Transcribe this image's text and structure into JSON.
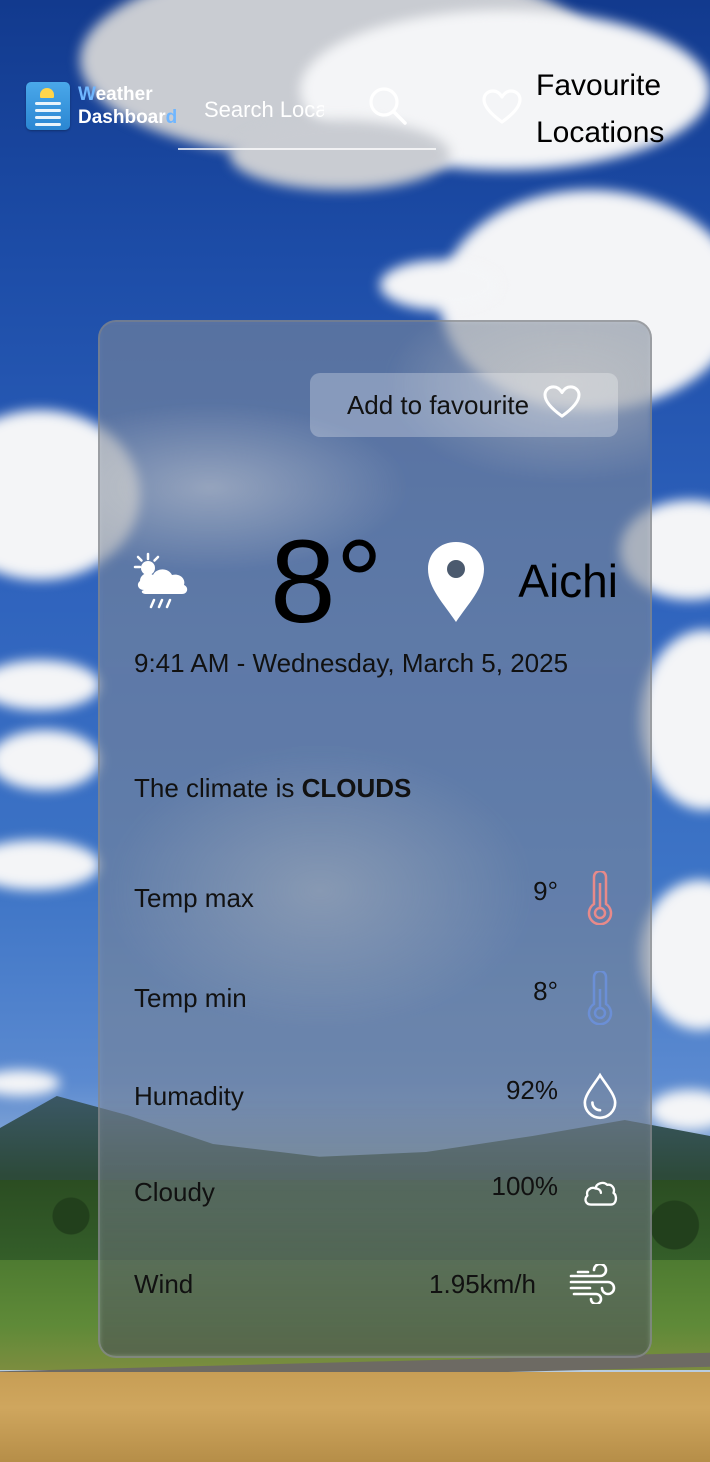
{
  "header": {
    "logo": {
      "line1": "Weather",
      "line2": "Dashboard"
    },
    "search": {
      "placeholder": "Search Location",
      "icon": "search-icon"
    },
    "favourites": {
      "label": "Favourite Locations",
      "icon": "heart-icon"
    }
  },
  "card": {
    "add_favourite_label": "Add to favourite",
    "weather_icon": "cloud-sun-rain-icon",
    "temperature": "8°",
    "city": "Aichi",
    "datetime": "9:41 AM - Wednesday, March 5, 2025",
    "climate_prefix": "The climate is",
    "climate": "CLOUDS",
    "stats": [
      {
        "label": "Temp max",
        "value": "9°",
        "icon": "thermometer-hot-icon",
        "color": "#e88a8a"
      },
      {
        "label": "Temp min",
        "value": "8°",
        "icon": "thermometer-cold-icon",
        "color": "#6b8fd6"
      },
      {
        "label": "Humadity",
        "value": "92%",
        "icon": "droplet-icon",
        "color": "#ffffff"
      },
      {
        "label": "Cloudy",
        "value": "100%",
        "icon": "cloud-icon",
        "color": "#ffffff"
      },
      {
        "label": "Wind",
        "value": "1.95km/h",
        "icon": "wind-icon",
        "color": "#ffffff"
      }
    ]
  }
}
